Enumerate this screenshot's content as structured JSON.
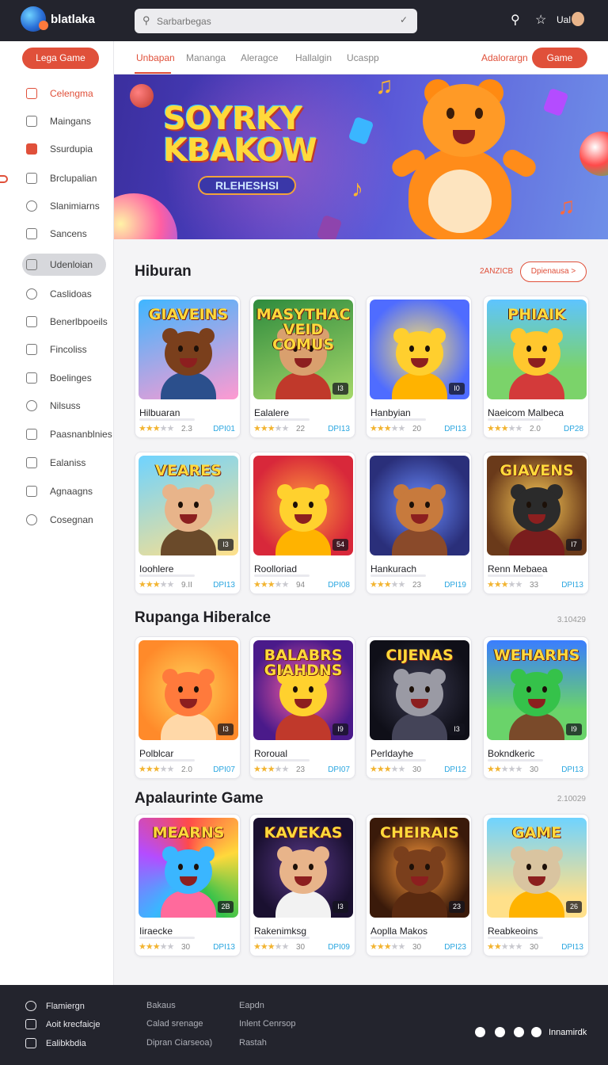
{
  "topbar": {
    "brand": "blatlaka",
    "search_placeholder": "Sarbarbegas",
    "user_label": "Ual"
  },
  "sidebar": {
    "primary_button": "Lega Game",
    "items": [
      {
        "label": "Celengma",
        "icon": "bag-icon"
      },
      {
        "label": "Maingans",
        "icon": "grid-icon"
      },
      {
        "label": "Ssurdupia",
        "icon": "shield-icon"
      },
      {
        "label": "Brclupalian",
        "icon": "list-icon"
      },
      {
        "label": "Slanimiarns",
        "icon": "compass-icon"
      },
      {
        "label": "Sancens",
        "icon": "folder-icon"
      },
      {
        "label": "Udenloian",
        "icon": "user-icon"
      },
      {
        "label": "Caslidoas",
        "icon": "chat-icon"
      },
      {
        "label": "Benerlbpoeils",
        "icon": "person-icon"
      },
      {
        "label": "Fincoliss",
        "icon": "home-icon"
      },
      {
        "label": "Boelinges",
        "icon": "doc-icon"
      },
      {
        "label": "Nilsuss",
        "icon": "phone-icon"
      },
      {
        "label": "Paasnanblnies",
        "icon": "calendar-icon"
      },
      {
        "label": "Ealaniss",
        "icon": "profile-icon"
      },
      {
        "label": "Agnaagns",
        "icon": "note-icon"
      },
      {
        "label": "Cosegnan",
        "icon": "search-icon"
      }
    ]
  },
  "tabs": {
    "items": [
      "Unbapan",
      "Manangа",
      "Aleragce",
      "Hallalgin",
      "Ucaspp"
    ],
    "link": "Adalorargn",
    "button": "Game"
  },
  "hero": {
    "title": "SOYRKY KBAKOW",
    "pill": "RLEHESHSI"
  },
  "sections": [
    {
      "title": "Hiburan",
      "link": "2ANZICB",
      "button": "Dpienausa >",
      "cards": [
        {
          "title": "GIAVEINS",
          "name": "Hilbuaran",
          "rating": "2.3",
          "tag": "DPI01",
          "badge": "",
          "stars": 3
        },
        {
          "title": "MASYTHAC VEID COMUS",
          "name": "Ealalere",
          "rating": "22",
          "tag": "DPI13",
          "badge": "I3",
          "stars": 3
        },
        {
          "title": "",
          "name": "Hanbyian",
          "rating": "20",
          "tag": "DPI13",
          "badge": "I0",
          "stars": 3
        },
        {
          "title": "PHIAIK",
          "name": "Naeicom Malbeca",
          "rating": "2.0",
          "tag": "DP28",
          "badge": "",
          "stars": 3
        },
        {
          "title": "VEARES",
          "name": "Ioohlere",
          "rating": "9.II",
          "tag": "DPI13",
          "badge": "I3",
          "stars": 3
        },
        {
          "title": "",
          "name": "Roolloriad",
          "rating": "94",
          "tag": "DPI08",
          "badge": "54",
          "stars": 3
        },
        {
          "title": "",
          "name": "Hankurach",
          "rating": "23",
          "tag": "DPI19",
          "badge": "",
          "stars": 3
        },
        {
          "title": "GIAVENS",
          "name": "Renn Mebaea",
          "rating": "33",
          "tag": "DPI13",
          "badge": "I7",
          "stars": 3
        }
      ]
    },
    {
      "title": "Rupanga Hiberalce",
      "meta": "3.10429",
      "cards": [
        {
          "title": "",
          "name": "Polblcar",
          "rating": "2.0",
          "tag": "DPI07",
          "badge": "I3",
          "stars": 3
        },
        {
          "title": "BALABRS GIAHDNS",
          "name": "Roroual",
          "rating": "23",
          "tag": "DPI07",
          "badge": "I9",
          "stars": 3
        },
        {
          "title": "CIJENAS",
          "name": "Perldayhe",
          "rating": "30",
          "tag": "DPI12",
          "badge": "I3",
          "stars": 3
        },
        {
          "title": "WEHARHS",
          "name": "Bokndkeric",
          "rating": "30",
          "tag": "DPI13",
          "badge": "I9",
          "stars": 2
        }
      ]
    },
    {
      "title": "Apalaurinte Game",
      "meta": "2.10029",
      "cards": [
        {
          "title": "MEARNS",
          "name": "Iiraecke",
          "rating": "30",
          "tag": "DPI13",
          "badge": "2B",
          "stars": 3
        },
        {
          "title": "KAVEKAS",
          "name": "Rakenimksg",
          "rating": "30",
          "tag": "DPI09",
          "badge": "I3",
          "stars": 3
        },
        {
          "title": "CHEIRAIS",
          "name": "Aoplla Makos",
          "rating": "30",
          "tag": "DPI23",
          "badge": "23",
          "stars": 3
        },
        {
          "title": "GAME",
          "name": "Reabkeoins",
          "rating": "30",
          "tag": "DPI13",
          "badge": "26",
          "stars": 2
        }
      ]
    }
  ],
  "footer": {
    "rows": [
      "Flamiergn",
      "Aoit krecfaicje",
      "Ealibkbdia"
    ],
    "col1": [
      "Bakaus",
      "Calad srenage",
      "Dipran Ciarseoa)"
    ],
    "col2": [
      "Eapdn",
      "Inlent Cenrsop",
      "Rastah"
    ],
    "brand": "Innamirdk"
  },
  "colors": {
    "accent": "#e0503a",
    "topbar": "#23242d",
    "link_blue": "#2aa6e0"
  }
}
